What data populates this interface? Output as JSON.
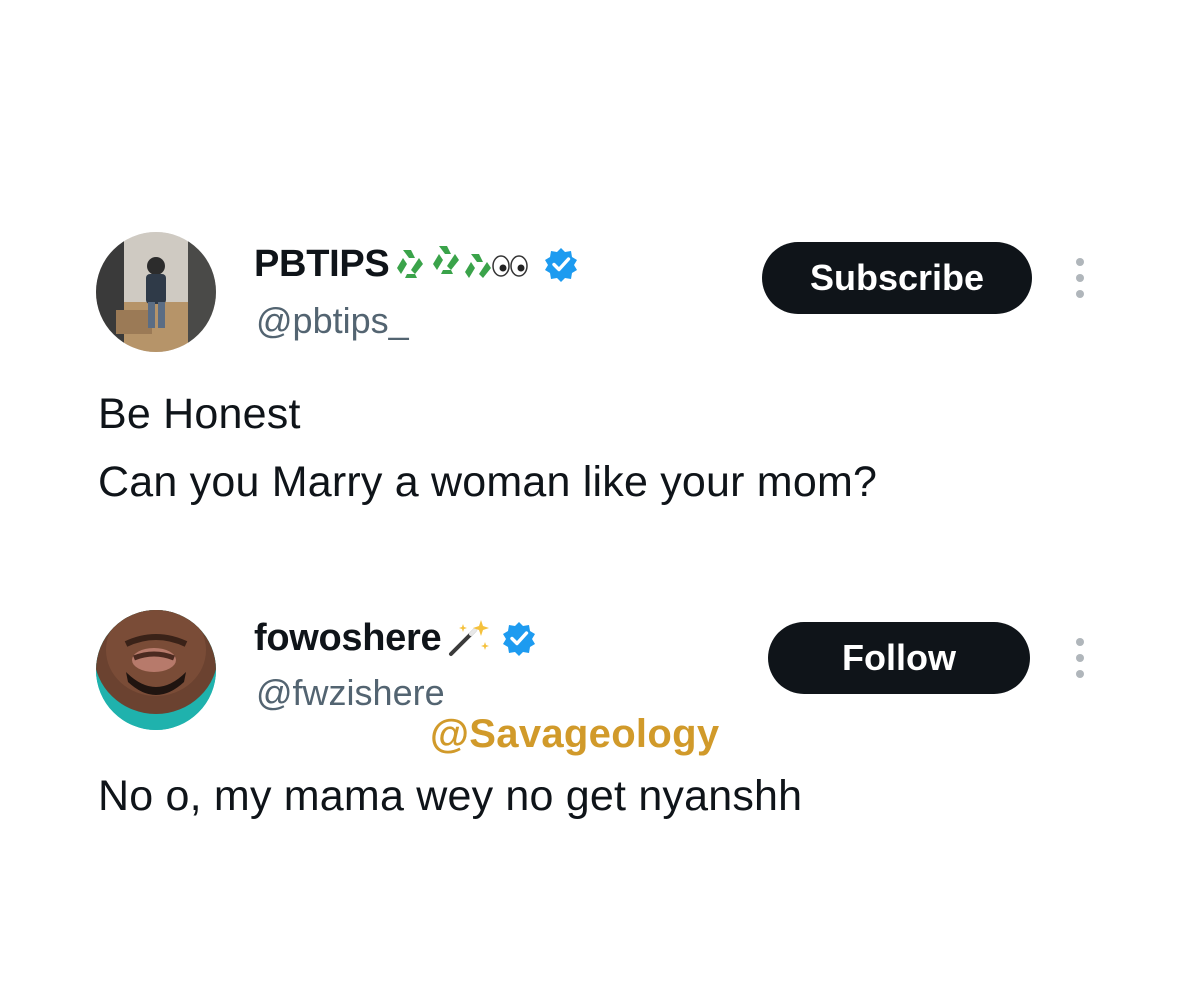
{
  "posts": [
    {
      "display_name": "PBTIPS",
      "name_emojis": "recycle-recycle-eyes",
      "handle": "@pbtips_",
      "verified": true,
      "action_label": "Subscribe",
      "text": "Be Honest\nCan you Marry a woman like your mom?"
    },
    {
      "display_name": "fowoshere",
      "name_emojis": "magic-wand",
      "handle": "@fwzishere",
      "verified": true,
      "action_label": "Follow",
      "text": "No o, my mama wey no get nyanshh"
    }
  ],
  "watermark": "@Savageology",
  "colors": {
    "verified_blue": "#1d9bf0",
    "button_bg": "#0f1419",
    "handle_gray": "#536471",
    "watermark_gold": "#d19a2a"
  }
}
